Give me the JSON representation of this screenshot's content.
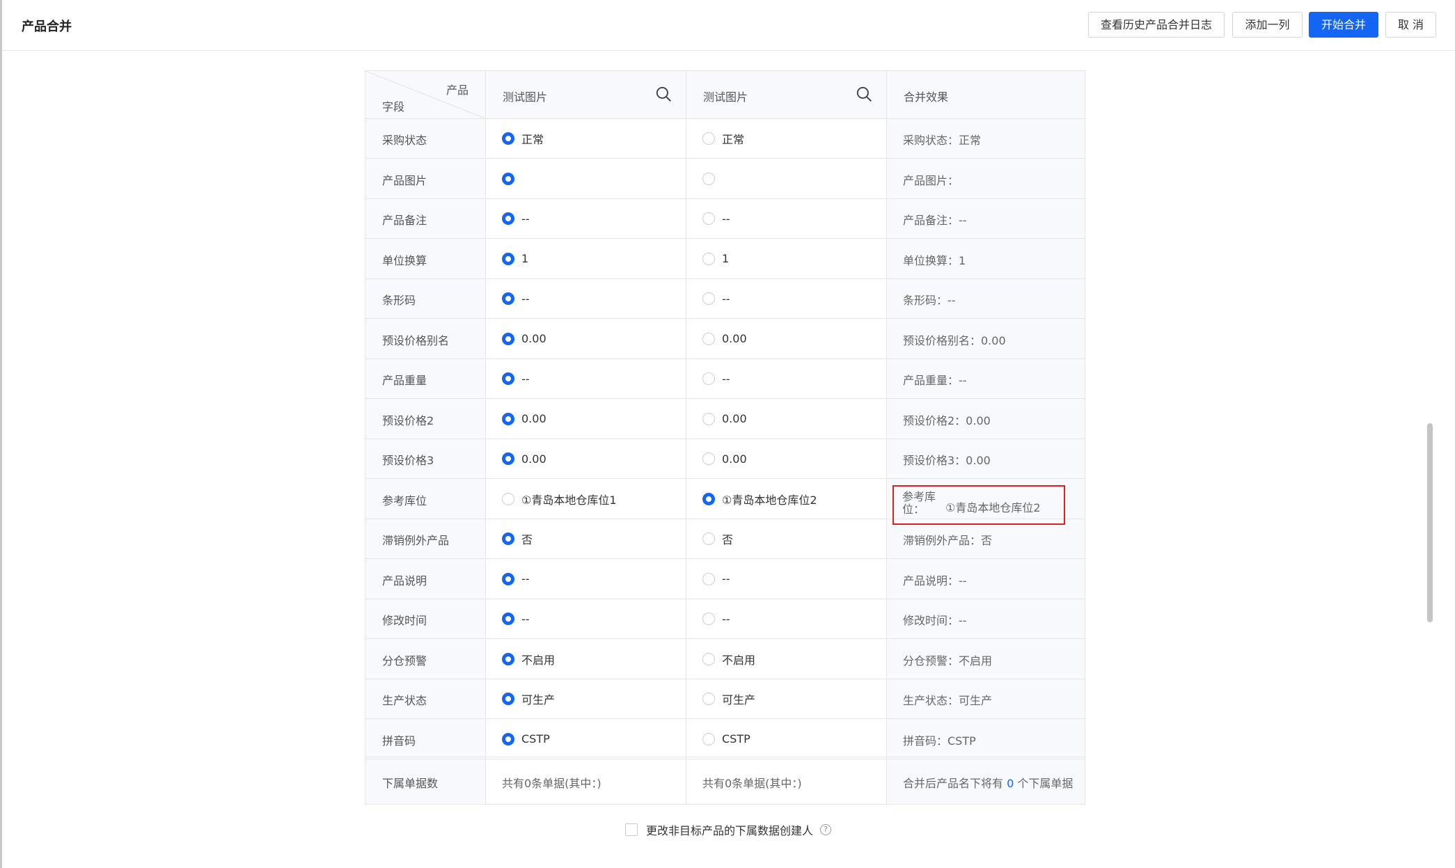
{
  "header": {
    "title": "产品合并",
    "buttons": {
      "history": "查看历史产品合并日志",
      "add_column": "添加一列",
      "start_merge": "开始合并",
      "cancel": "取 消"
    }
  },
  "table": {
    "header": {
      "diag_top": "产品",
      "diag_bottom": "字段",
      "col_a": "测试图片",
      "col_b": "测试图片",
      "col_merge": "合并效果"
    },
    "rows": [
      {
        "label": "采购状态",
        "a": "正常",
        "b": "正常",
        "selected": "a",
        "merge": "采购状态：正常"
      },
      {
        "label": "产品图片",
        "a": "",
        "b": "",
        "selected": "a",
        "merge": "产品图片："
      },
      {
        "label": "产品备注",
        "a": "--",
        "b": "--",
        "selected": "a",
        "merge": "产品备注：--"
      },
      {
        "label": "单位换算",
        "a": "1",
        "b": "1",
        "selected": "a",
        "merge": "单位换算：1"
      },
      {
        "label": "条形码",
        "a": "--",
        "b": "--",
        "selected": "a",
        "merge": "条形码：--"
      },
      {
        "label": "预设价格别名",
        "a": "0.00",
        "b": "0.00",
        "selected": "a",
        "merge": "预设价格别名：0.00"
      },
      {
        "label": "产品重量",
        "a": "--",
        "b": "--",
        "selected": "a",
        "merge": "产品重量：--"
      },
      {
        "label": "预设价格2",
        "a": "0.00",
        "b": "0.00",
        "selected": "a",
        "merge": "预设价格2：0.00"
      },
      {
        "label": "预设价格3",
        "a": "0.00",
        "b": "0.00",
        "selected": "a",
        "merge": "预设价格3：0.00"
      },
      {
        "label": "参考库位",
        "a": "①青岛本地仓库位1",
        "b": "①青岛本地仓库位2",
        "selected": "b",
        "merge_label": "参考库位：",
        "merge_value": "①青岛本地仓库位2"
      },
      {
        "label": "滞销例外产品",
        "a": "否",
        "b": "否",
        "selected": "a",
        "merge": "滞销例外产品：否"
      },
      {
        "label": "产品说明",
        "a": "--",
        "b": "--",
        "selected": "a",
        "merge": "产品说明：--"
      },
      {
        "label": "修改时间",
        "a": "--",
        "b": "--",
        "selected": "a",
        "merge": "修改时间：--"
      },
      {
        "label": "分仓预警",
        "a": "不启用",
        "b": "不启用",
        "selected": "a",
        "merge": "分仓预警：不启用"
      },
      {
        "label": "生产状态",
        "a": "可生产",
        "b": "可生产",
        "selected": "a",
        "merge": "生产状态：可生产"
      },
      {
        "label": "拼音码",
        "a": "CSTP",
        "b": "CSTP",
        "selected": "a",
        "merge": "拼音码：CSTP"
      }
    ],
    "footer": {
      "label": "下属单据数",
      "a": "共有0条单据(其中：)",
      "b": "共有0条单据(其中：)",
      "merge_prefix": "合并后产品名下将有 ",
      "merge_count": "0",
      "merge_suffix": " 个下属单据"
    }
  },
  "bottom": {
    "checkbox_label": "更改非目标产品的下属数据创建人",
    "help_icon": "question-circle-icon"
  },
  "colors": {
    "primary": "#1565f5",
    "highlight": "#e02020"
  }
}
